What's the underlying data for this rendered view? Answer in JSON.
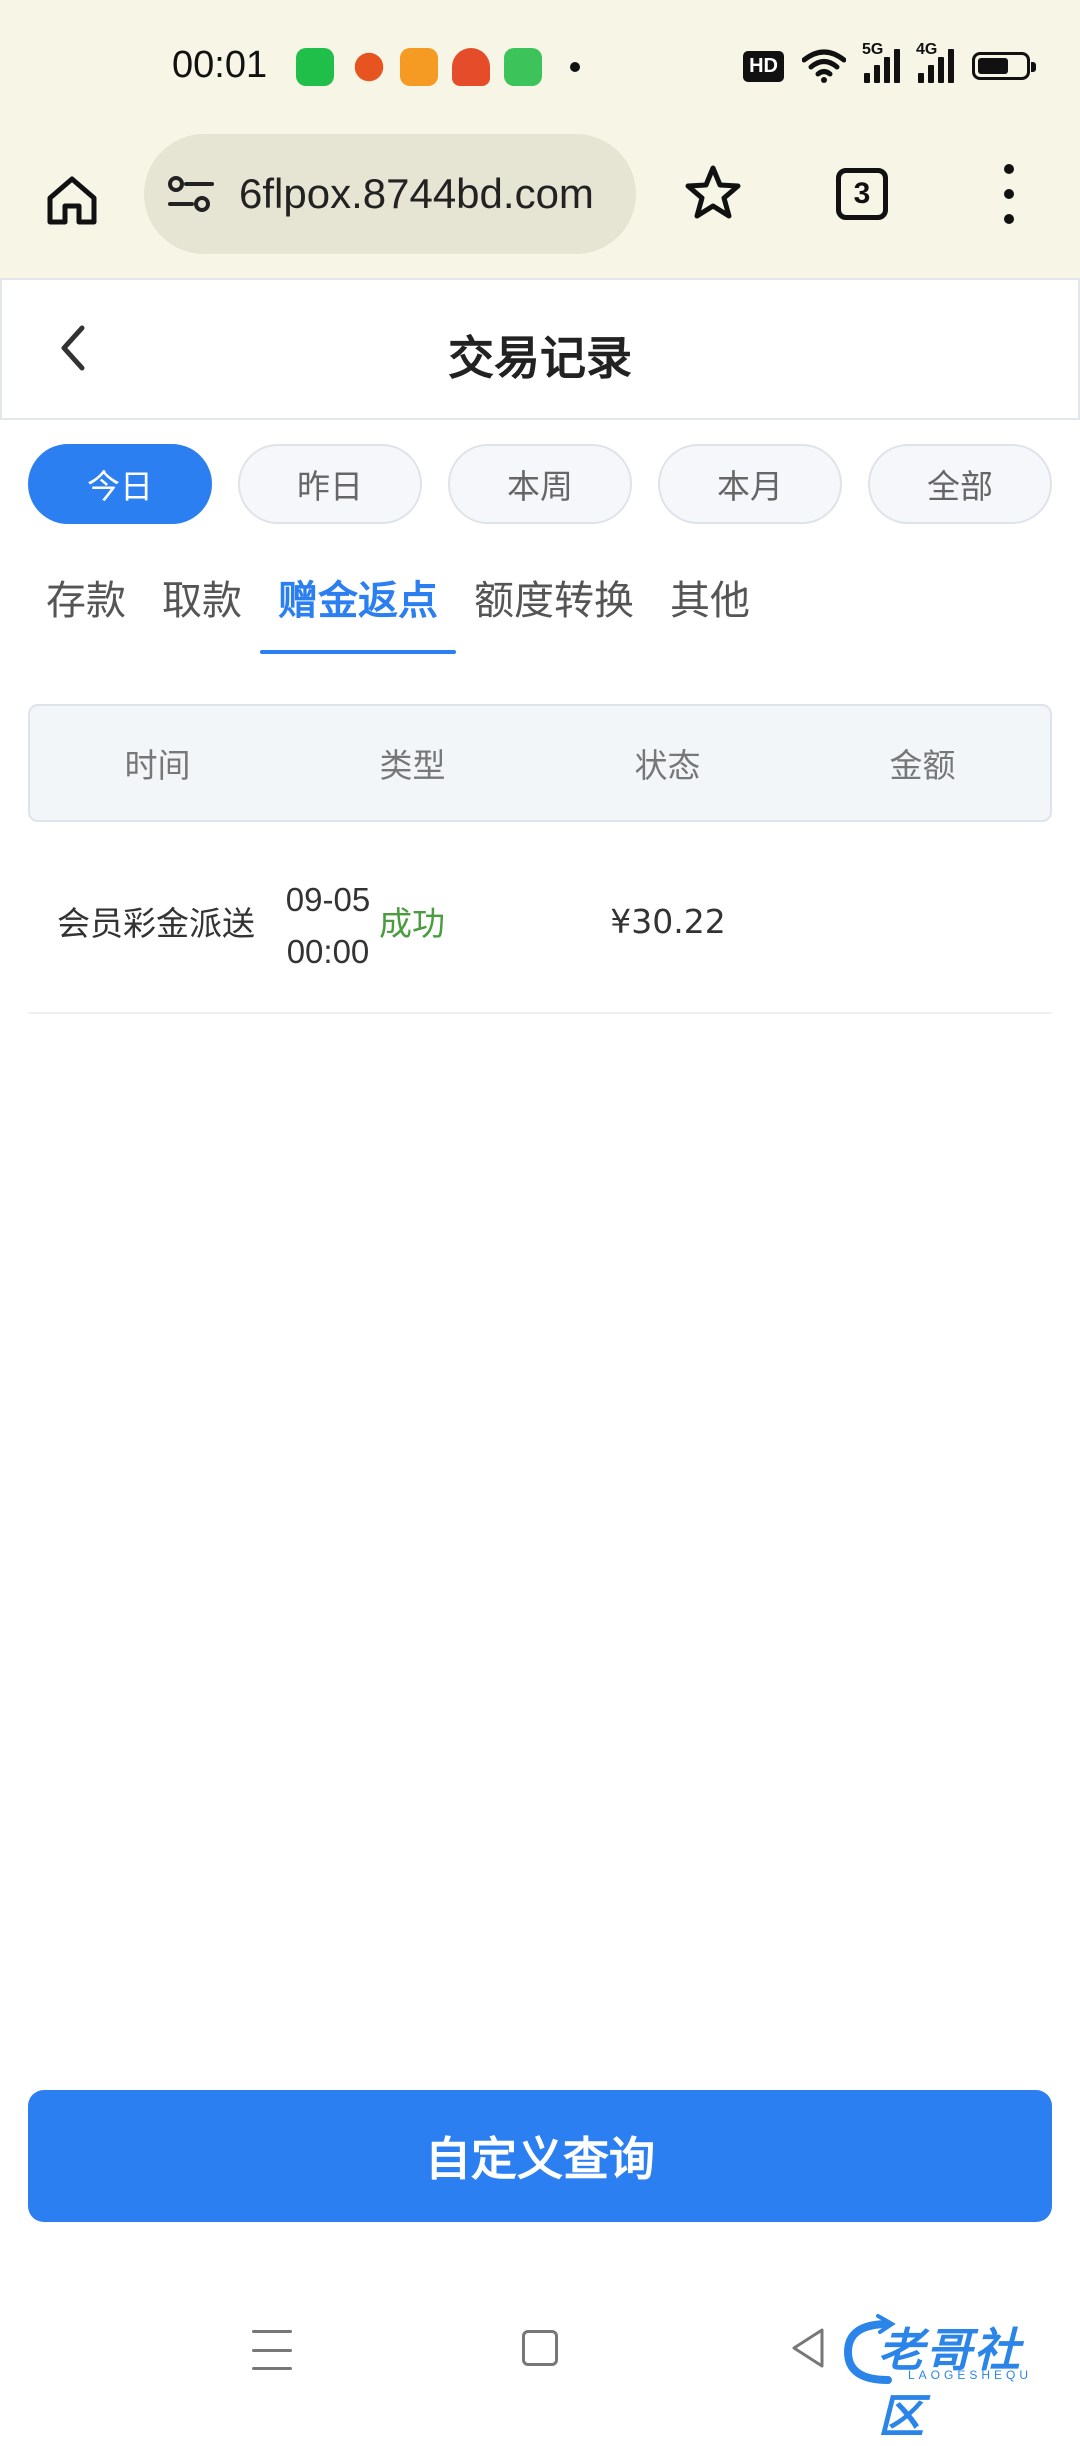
{
  "status_bar": {
    "time": "00:01",
    "hd_label": "HD",
    "signal_5g": "5G",
    "signal_4g": "4G"
  },
  "browser": {
    "url": "6flpox.8744bd.com",
    "tab_count": "3"
  },
  "header": {
    "title": "交易记录"
  },
  "date_filters": [
    {
      "label": "今日",
      "active": true
    },
    {
      "label": "昨日",
      "active": false
    },
    {
      "label": "本周",
      "active": false
    },
    {
      "label": "本月",
      "active": false
    },
    {
      "label": "全部",
      "active": false
    }
  ],
  "category_tabs": [
    {
      "label": "存款",
      "active": false
    },
    {
      "label": "取款",
      "active": false
    },
    {
      "label": "赠金返点",
      "active": true
    },
    {
      "label": "额度转换",
      "active": false
    },
    {
      "label": "其他",
      "active": false
    }
  ],
  "table": {
    "columns": [
      "时间",
      "类型",
      "状态",
      "金额"
    ],
    "rows": [
      {
        "date": "09-05",
        "time": "00:00",
        "type": "会员彩金派送",
        "status": "成功",
        "amount": "¥30.22"
      }
    ]
  },
  "footer": {
    "query_button": "自定义查询"
  },
  "watermark": {
    "text": "老哥社区",
    "subtext": "LAOGESHEQU"
  },
  "colors": {
    "accent": "#2b7ff0",
    "success": "#4a9c3f",
    "chrome_bg": "#f6f5e6"
  }
}
